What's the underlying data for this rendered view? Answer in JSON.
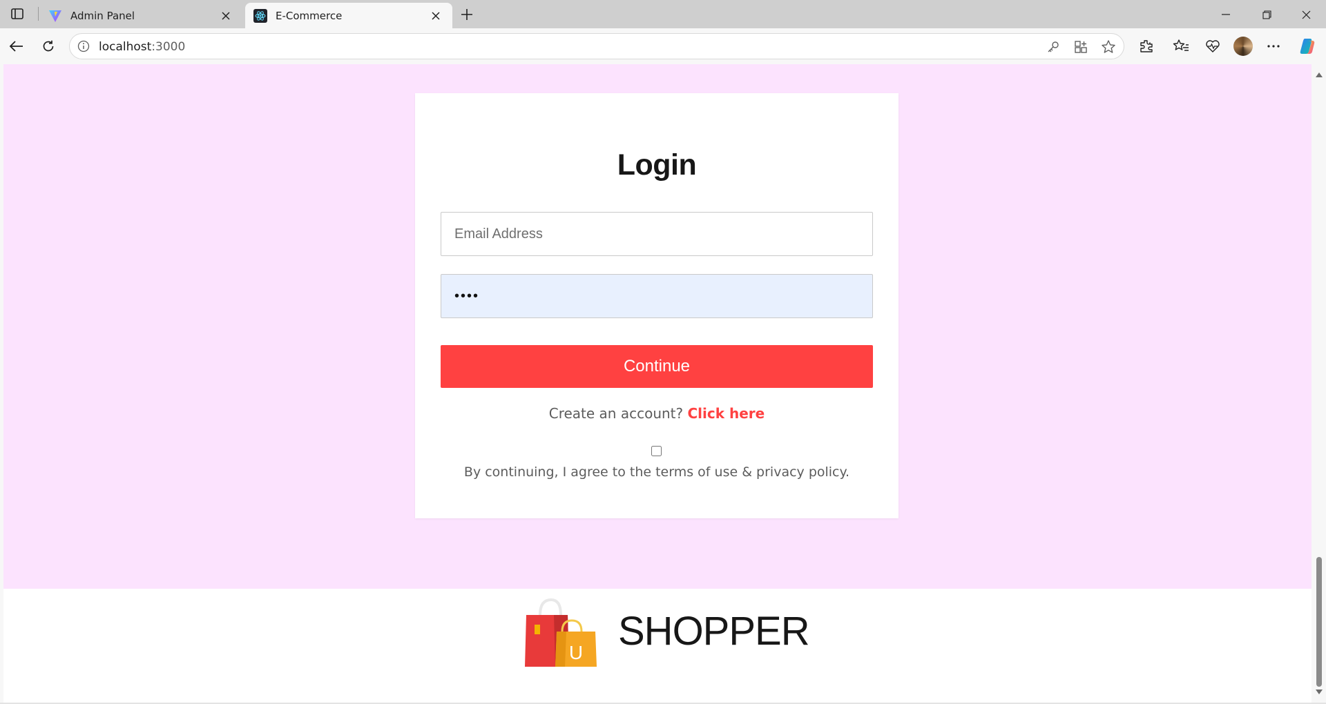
{
  "browser": {
    "tabs": [
      {
        "title": "Admin Panel",
        "favicon": "vite-logo-icon",
        "active": false
      },
      {
        "title": "E-Commerce",
        "favicon": "react-logo-icon",
        "active": true
      }
    ],
    "url": {
      "host": "localhost",
      "port": ":3000"
    }
  },
  "login": {
    "title": "Login",
    "email_placeholder": "Email Address",
    "email_value": "",
    "password_value": "••••",
    "continue_label": "Continue",
    "create_account_text": "Create an account? ",
    "click_here_label": "Click here",
    "agree_checked": false,
    "agree_text": "By continuing, I agree to the terms of use & privacy policy."
  },
  "footer": {
    "brand": "SHOPPER",
    "logo": "shopping-bag-icon"
  },
  "colors": {
    "accent": "#ff4141",
    "page_background": "#fce3fe",
    "autofill": "#e8f0fe"
  }
}
